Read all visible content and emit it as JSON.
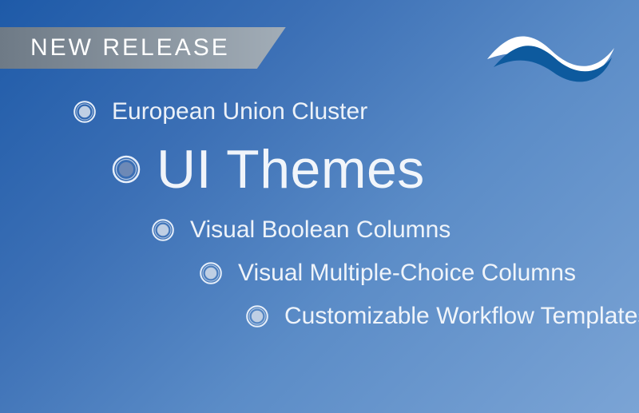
{
  "banner": {
    "label": "NEW RELEASE"
  },
  "logo": {
    "name": "wave-logo"
  },
  "colors": {
    "logo_dark": "#0d5a9e",
    "logo_light": "#6aa3d2",
    "bullet_ring": "#e6eef9",
    "bullet_core": "#b4c6e0"
  },
  "features": [
    {
      "label": "European Union Cluster",
      "featured": false
    },
    {
      "label": "UI Themes",
      "featured": true
    },
    {
      "label": "Visual Boolean Columns",
      "featured": false
    },
    {
      "label": "Visual Multiple-Choice Columns",
      "featured": false
    },
    {
      "label": "Customizable Workflow Templates",
      "featured": false
    }
  ]
}
